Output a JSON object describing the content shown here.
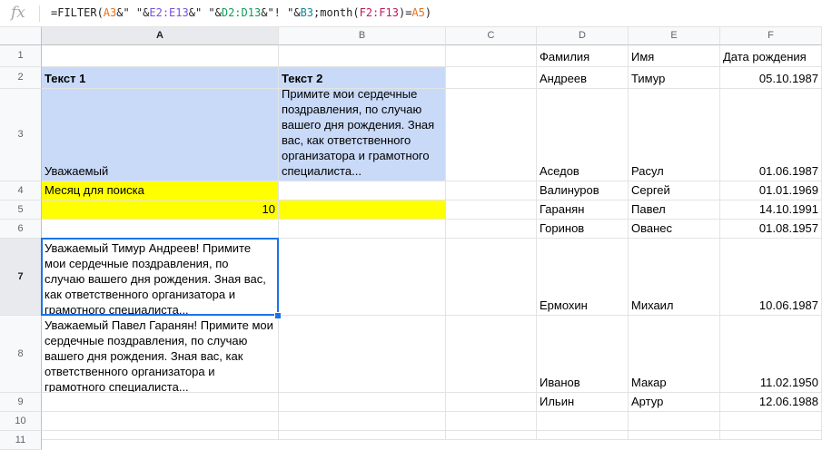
{
  "formula_bar": {
    "fx_label": "fx",
    "formula_parts": [
      {
        "text": "=FILTER(",
        "color": "plain"
      },
      {
        "text": "A3",
        "color": "orange"
      },
      {
        "text": "&\" \"&",
        "color": "plain"
      },
      {
        "text": "E2:E13",
        "color": "purple"
      },
      {
        "text": "&\" \"&",
        "color": "plain"
      },
      {
        "text": "D2:D13",
        "color": "green"
      },
      {
        "text": "&\"! \"&",
        "color": "plain"
      },
      {
        "text": "B3",
        "color": "teal"
      },
      {
        "text": ";month(",
        "color": "plain"
      },
      {
        "text": "F2:F13",
        "color": "pink"
      },
      {
        "text": ")=",
        "color": "plain"
      },
      {
        "text": "A5",
        "color": "orange"
      },
      {
        "text": ")",
        "color": "plain"
      }
    ]
  },
  "columns": [
    "A",
    "B",
    "C",
    "D",
    "E",
    "F"
  ],
  "rows": [
    "1",
    "2",
    "3",
    "4",
    "5",
    "6",
    "7",
    "8",
    "9",
    "10",
    "11"
  ],
  "cells": {
    "D1": "Фамилия",
    "E1": "Имя",
    "F1": "Дата рождения",
    "A2": "Текст 1",
    "B2": "Текст 2",
    "D2": "Андреев",
    "E2": "Тимур",
    "F2": "05.10.1987",
    "A3": "Уважаемый",
    "B3": "Примите мои сердечные поздравления, по случаю вашего дня рождения. Зная вас, как ответственного организатора и грамотного специалиста...",
    "D3": "Аседов",
    "E3": "Расул",
    "F3": "01.06.1987",
    "A4": "Месяц для поиска",
    "D4": "Валинуров",
    "E4": "Сергей",
    "F4": "01.01.1969",
    "A5": "10",
    "D5": "Гаранян",
    "E5": "Павел",
    "F5": "14.10.1991",
    "D6": "Горинов",
    "E6": "Ованес",
    "F6": "01.08.1957",
    "A7": "Уважаемый Тимур Андреев! Примите мои сердечные поздравления, по случаю вашего дня рождения. Зная вас, как ответственного организатора и грамотного специалиста...",
    "D7": "Ермохин",
    "E7": "Михаил",
    "F7": "10.06.1987",
    "A8": "Уважаемый Павел Гаранян! Примите мои сердечные поздравления, по случаю вашего дня рождения. Зная вас, как ответственного организатора и грамотного специалиста...",
    "D8": "Иванов",
    "E8": "Макар",
    "F8": "11.02.1950",
    "D9": "Ильин",
    "E9": "Артур",
    "F9": "12.06.1988"
  },
  "colors": {
    "selection": "#1a73e8",
    "header_fill": "#c9daf8",
    "highlight": "#ffff00"
  },
  "selected_cell": "A7"
}
